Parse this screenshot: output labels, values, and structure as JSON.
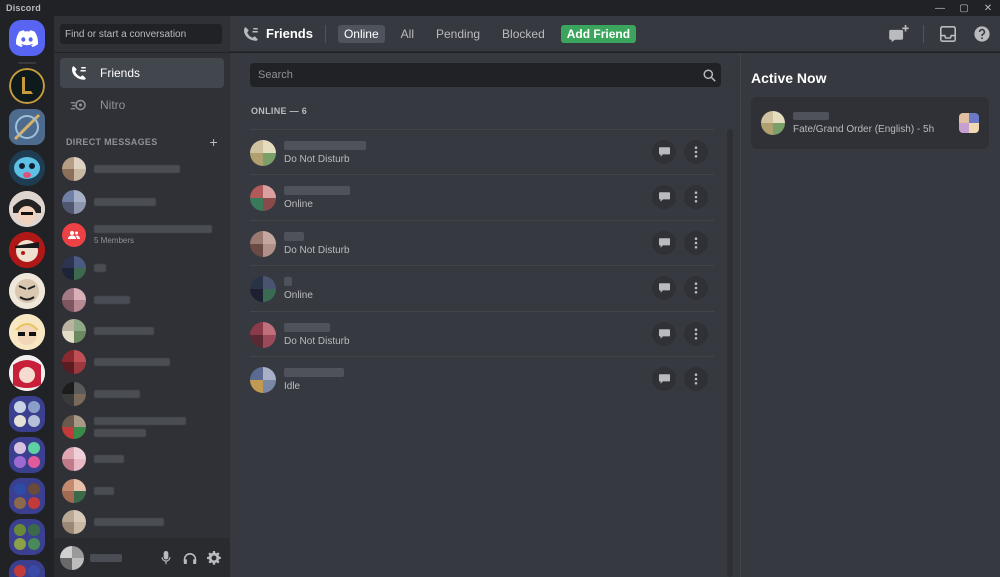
{
  "window": {
    "title": "Discord",
    "controls": [
      "—",
      "▢",
      "✕"
    ]
  },
  "colors": {
    "brand": "#5865f2",
    "add_friend_green": "#3ba55d",
    "group_red": "#ed4245"
  },
  "sidebar": {
    "search_placeholder": "Find or start a conversation",
    "nav": [
      {
        "label": "Friends",
        "icon": "friends-icon",
        "active": true
      },
      {
        "label": "Nitro",
        "icon": "nitro-icon",
        "active": false
      }
    ],
    "dm_header": "DIRECT MESSAGES",
    "dm_add": "+",
    "group_sub": "5 Members"
  },
  "header": {
    "title": "Friends",
    "tabs": [
      {
        "label": "Online",
        "active": true
      },
      {
        "label": "All"
      },
      {
        "label": "Pending"
      },
      {
        "label": "Blocked"
      }
    ],
    "add_friend": "Add Friend"
  },
  "main": {
    "search_placeholder": "Search",
    "online_heading": "ONLINE — 6",
    "friends": [
      {
        "status": "Do Not Disturb"
      },
      {
        "status": "Online"
      },
      {
        "status": "Do Not Disturb"
      },
      {
        "status": "Online"
      },
      {
        "status": "Do Not Disturb"
      },
      {
        "status": "Idle"
      }
    ]
  },
  "active_now": {
    "title": "Active Now",
    "game": "Fate/Grand Order (English) - 5h"
  }
}
